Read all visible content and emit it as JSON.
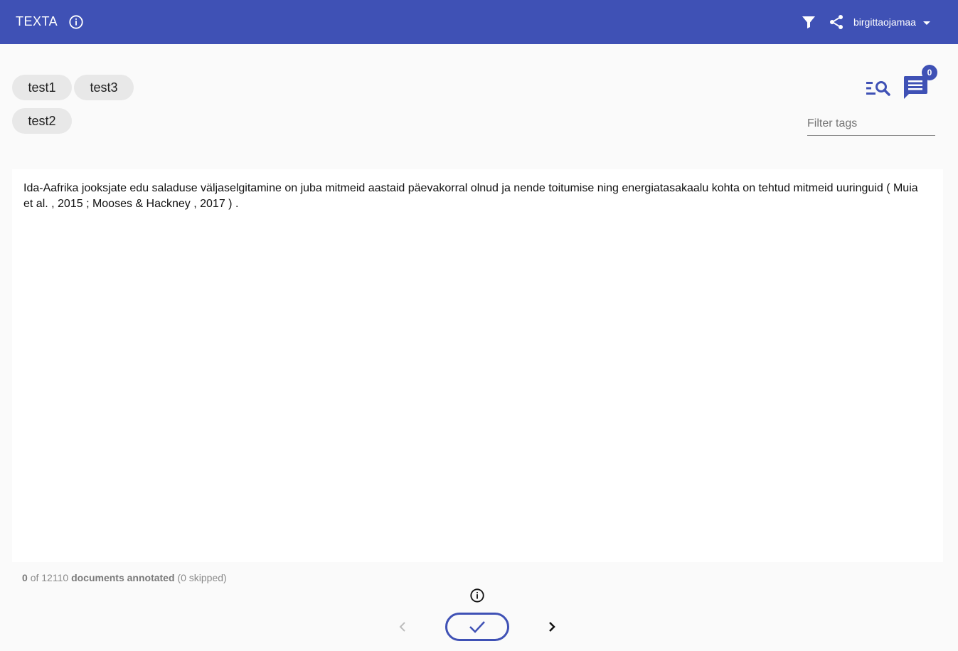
{
  "app": {
    "logo": "TEXTA",
    "username": "birgittaojamaa"
  },
  "header": {
    "info_icon": "info-icon",
    "filter_icon": "filter-icon",
    "share_icon": "share-icon",
    "dropdown_icon": "caret-down-icon"
  },
  "tags": [
    "test1",
    "test3",
    "test2"
  ],
  "tools": {
    "search_icon": "list-search-icon",
    "comment_icon": "comment-icon",
    "comment_count": "0",
    "filter_placeholder": "Filter tags"
  },
  "document": {
    "text": "Ida-Aafrika jooksjate edu saladuse väljaselgitamine on juba mitmeid aastaid päevakorral olnud ja nende toitumise ning energiatasakaalu kohta on tehtud mitmeid uuringuid ( Muia et al. , 2015 ; Mooses & Hackney , 2017 ) ."
  },
  "status": {
    "annotated": "0",
    "of_label": "of",
    "total": "12110",
    "documents_label": "documents annotated",
    "skipped": "(0 skipped)"
  },
  "nav": {
    "info_icon": "info-icon",
    "prev_icon": "chevron-left-icon",
    "confirm_icon": "check-icon",
    "next_icon": "chevron-right-icon"
  },
  "colors": {
    "primary": "#3f51b5",
    "chip_bg": "#e8e8e8",
    "page_bg": "#fafafa"
  }
}
